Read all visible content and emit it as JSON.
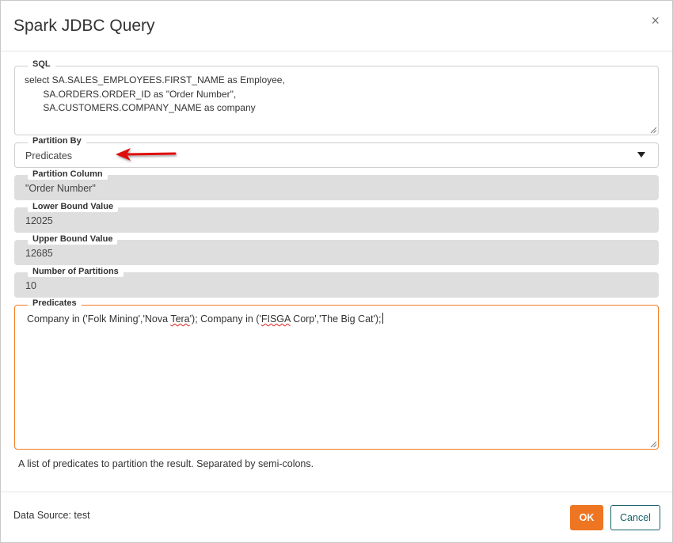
{
  "dialog": {
    "title": "Spark JDBC Query",
    "close_symbol": "×"
  },
  "sql": {
    "label": "SQL",
    "value": "select SA.SALES_EMPLOYEES.FIRST_NAME as Employee,\n       SA.ORDERS.ORDER_ID as \"Order Number\",\n       SA.CUSTOMERS.COMPANY_NAME as company"
  },
  "partition_by": {
    "label": "Partition By",
    "value": "Predicates"
  },
  "partition_column": {
    "label": "Partition Column",
    "value": "\"Order Number\""
  },
  "lower_bound": {
    "label": "Lower Bound Value",
    "value": "12025"
  },
  "upper_bound": {
    "label": "Upper Bound Value",
    "value": "12685"
  },
  "num_partitions": {
    "label": "Number of Partitions",
    "value": "10"
  },
  "predicates": {
    "label": "Predicates",
    "value_parts": [
      "Company in ('Folk Mining','Nova ",
      "Tera",
      "'); Company in ('",
      "FISGA",
      " Corp','The Big Cat');"
    ],
    "helper": "A list of predicates to partition the result. Separated by semi-colons."
  },
  "footer": {
    "data_source": "Data Source: test",
    "ok_label": "OK",
    "cancel_label": "Cancel"
  },
  "colors": {
    "accent_orange": "#ee7623",
    "cancel_teal": "#17606d",
    "annotation_red": "#e01010",
    "disabled_gray": "#dedede"
  }
}
